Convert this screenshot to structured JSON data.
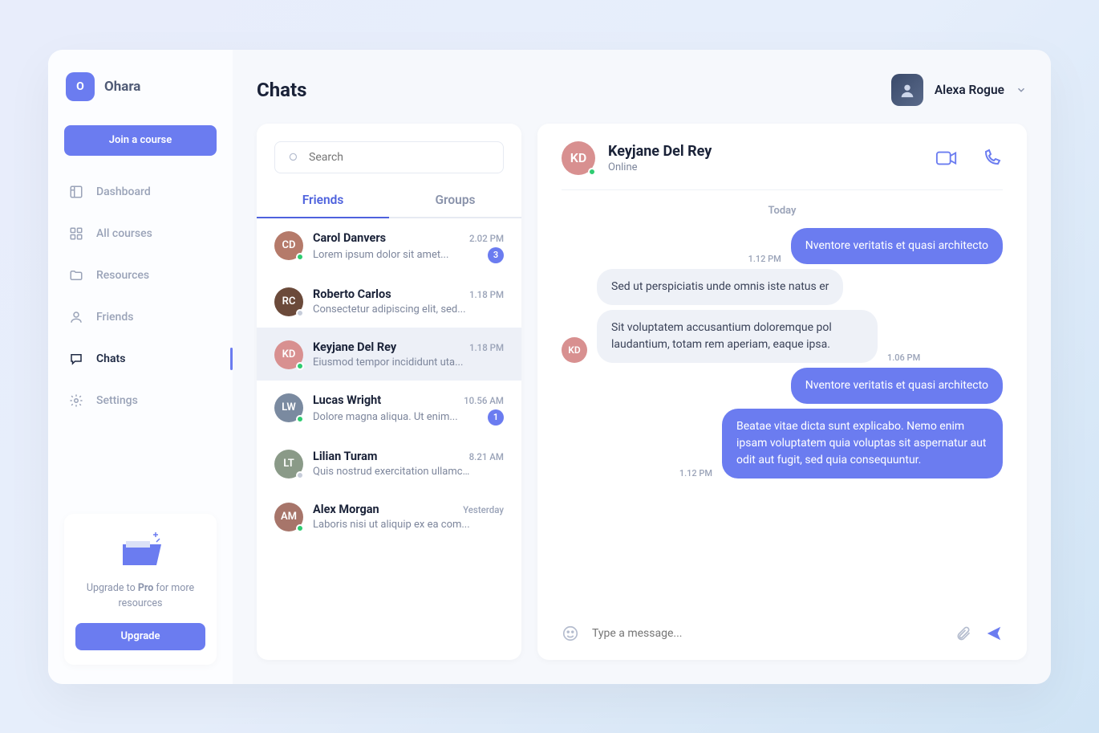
{
  "brand": {
    "logo_letter": "O",
    "name": "Ohara"
  },
  "sidebar": {
    "join_label": "Join a course",
    "items": [
      {
        "label": "Dashboard",
        "active": false
      },
      {
        "label": "All courses",
        "active": false
      },
      {
        "label": "Resources",
        "active": false
      },
      {
        "label": "Friends",
        "active": false
      },
      {
        "label": "Chats",
        "active": true
      },
      {
        "label": "Settings",
        "active": false
      }
    ],
    "upgrade": {
      "text_pre": "Upgrade to ",
      "text_bold": "Pro",
      "text_post": " for more resources",
      "button": "Upgrade"
    }
  },
  "header": {
    "title": "Chats",
    "user_name": "Alexa Rogue"
  },
  "search": {
    "placeholder": "Search"
  },
  "tabs": {
    "friends": "Friends",
    "groups": "Groups"
  },
  "chats": [
    {
      "name": "Carol Danvers",
      "preview": "Lorem ipsum dolor sit amet...",
      "time": "2.02 PM",
      "badge": "3",
      "status": "online",
      "color": "#b57a6a"
    },
    {
      "name": "Roberto Carlos",
      "preview": "Consectetur adipiscing elit, sed...",
      "time": "1.18 PM",
      "badge": null,
      "status": "away",
      "color": "#6b4a3a"
    },
    {
      "name": "Keyjane Del Rey",
      "preview": " Eiusmod tempor incididunt uta...",
      "time": "1.18 PM",
      "badge": null,
      "status": "online",
      "color": "#d89090",
      "active": true
    },
    {
      "name": "Lucas Wright",
      "preview": "Dolore magna aliqua. Ut enim...",
      "time": "10.56 AM",
      "badge": "1",
      "status": "online",
      "color": "#7a8aa0"
    },
    {
      "name": "Lilian Turam",
      "preview": "Quis nostrud exercitation ullamco...",
      "time": "8.21 AM",
      "badge": null,
      "status": "away",
      "color": "#8a9a88"
    },
    {
      "name": "Alex Morgan",
      "preview": "Laboris nisi ut aliquip ex ea com...",
      "time": "Yesterday",
      "badge": null,
      "status": "online",
      "color": "#a7756a"
    }
  ],
  "conversation": {
    "contact": {
      "name": "Keyjane Del Rey",
      "status": "Online",
      "color": "#d89090"
    },
    "day": "Today",
    "messages": [
      {
        "side": "me",
        "text": "Nventore veritatis et quasi architecto",
        "ts": "1.12 PM",
        "ts_show": "before"
      },
      {
        "side": "them",
        "text": "Sed ut perspiciatis unde omnis iste natus er"
      },
      {
        "side": "them",
        "text": "Sit voluptatem accusantium doloremque pol laudantium, totam rem aperiam, eaque ipsa.",
        "ts": "1.06 PM",
        "show_av": true
      },
      {
        "side": "me",
        "text": "Nventore veritatis et quasi architecto"
      },
      {
        "side": "me",
        "text": "Beatae vitae dicta sunt explicabo. Nemo enim ipsam voluptatem quia voluptas sit aspernatur aut odit aut fugit, sed quia consequuntur.",
        "ts": "1.12 PM",
        "ts_show": "before"
      }
    ],
    "composer": {
      "placeholder": "Type a message..."
    }
  }
}
